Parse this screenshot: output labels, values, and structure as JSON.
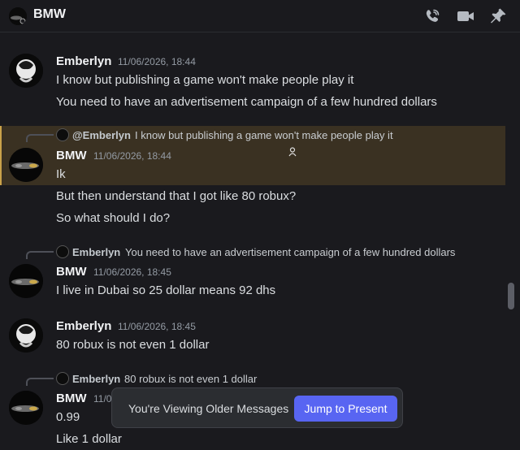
{
  "header": {
    "title": "BMW",
    "icons": [
      "phone-call-icon",
      "video-camera-icon",
      "pin-icon"
    ]
  },
  "messages": [
    {
      "author": "Emberlyn",
      "timestamp": "11/06/2026, 18:44",
      "lines": [
        "I know but publishing a game won't make people play it",
        "You need to have an advertisement campaign of a few hundred dollars"
      ]
    },
    {
      "reply": {
        "name": "@Emberlyn",
        "text": "I know but publishing a game won't make people play it"
      },
      "author": "BMW",
      "timestamp": "11/06/2026, 18:44",
      "lines": [
        "Ik",
        "But then understand that I got like 80 robux?",
        "So what should I do?"
      ]
    },
    {
      "reply": {
        "name": "Emberlyn",
        "text": "You need to have an advertisement campaign of a few hundred dollars"
      },
      "author": "BMW",
      "timestamp": "11/06/2026, 18:45",
      "lines": [
        "I live in Dubai so 25 dollar means 92 dhs"
      ]
    },
    {
      "author": "Emberlyn",
      "timestamp": "11/06/2026, 18:45",
      "lines": [
        "80 robux is not even 1 dollar"
      ]
    },
    {
      "reply": {
        "name": "Emberlyn",
        "text": "80 robux is not even 1 dollar"
      },
      "author": "BMW",
      "timestamp": "11/0",
      "lines": [
        "0.99",
        "Like 1 dollar"
      ]
    }
  ],
  "toast": {
    "label": "You're Viewing Older Messages",
    "button": "Jump to Present"
  },
  "colors": {
    "background": "#1a1a1e",
    "highlight": "#3a3122",
    "accent": "#5865f2"
  }
}
